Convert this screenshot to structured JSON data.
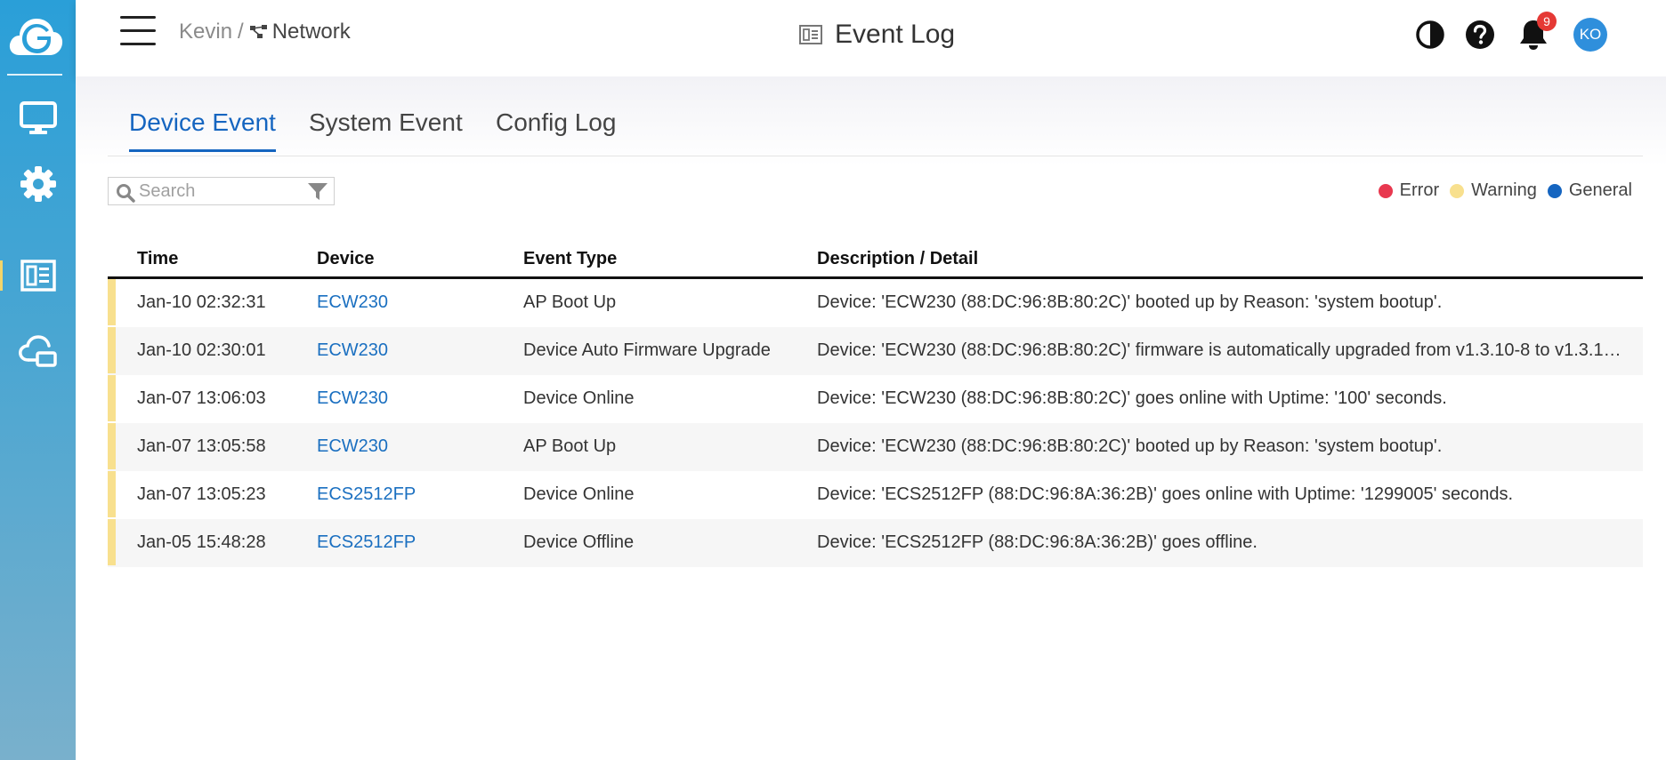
{
  "colors": {
    "error": "#e8384f",
    "warning": "#f8e08e",
    "general": "#1565c0",
    "accent": "#1565c0",
    "sidebar": "#2a9fd8"
  },
  "sidebar": {
    "logo_icon": "cloud-g-logo",
    "items": [
      {
        "icon": "monitor-icon"
      },
      {
        "icon": "gear-icon"
      },
      {
        "icon": "event-log-icon"
      },
      {
        "icon": "cloud-devices-icon"
      }
    ]
  },
  "header": {
    "breadcrumb": {
      "parent": "Kevin",
      "separator": "/",
      "current": "Network"
    },
    "title": "Event Log",
    "notifications_count": "9",
    "avatar_initials": "KO"
  },
  "tabs": [
    {
      "label": "Device Event"
    },
    {
      "label": "System Event"
    },
    {
      "label": "Config Log"
    }
  ],
  "search": {
    "placeholder": "Search",
    "value": ""
  },
  "legend": [
    {
      "label": "Error",
      "color": "#e8384f"
    },
    {
      "label": "Warning",
      "color": "#f8e08e"
    },
    {
      "label": "General",
      "color": "#1565c0"
    }
  ],
  "table": {
    "headers": {
      "time": "Time",
      "device": "Device",
      "event_type": "Event Type",
      "description": "Description / Detail"
    },
    "rows": [
      {
        "level": "warning",
        "time": "Jan-10 02:32:31",
        "device": "ECW230",
        "event_type": "AP Boot Up",
        "description": "Device: 'ECW230 (88:DC:96:8B:80:2C)' booted up by Reason: 'system bootup'."
      },
      {
        "level": "warning",
        "time": "Jan-10 02:30:01",
        "device": "ECW230",
        "event_type": "Device Auto Firmware Upgrade",
        "description": "Device: 'ECW230 (88:DC:96:8B:80:2C)' firmware is automatically upgraded from v1.3.10-8 to v1.3.1…"
      },
      {
        "level": "warning",
        "time": "Jan-07 13:06:03",
        "device": "ECW230",
        "event_type": "Device Online",
        "description": "Device: 'ECW230 (88:DC:96:8B:80:2C)' goes online with Uptime: '100' seconds."
      },
      {
        "level": "warning",
        "time": "Jan-07 13:05:58",
        "device": "ECW230",
        "event_type": "AP Boot Up",
        "description": "Device: 'ECW230 (88:DC:96:8B:80:2C)' booted up by Reason: 'system bootup'."
      },
      {
        "level": "warning",
        "time": "Jan-07 13:05:23",
        "device": "ECS2512FP",
        "event_type": "Device Online",
        "description": "Device: 'ECS2512FP (88:DC:96:8A:36:2B)' goes online with Uptime: '1299005' seconds."
      },
      {
        "level": "warning",
        "time": "Jan-05 15:48:28",
        "device": "ECS2512FP",
        "event_type": "Device Offline",
        "description": "Device: 'ECS2512FP (88:DC:96:8A:36:2B)' goes offline."
      }
    ]
  }
}
